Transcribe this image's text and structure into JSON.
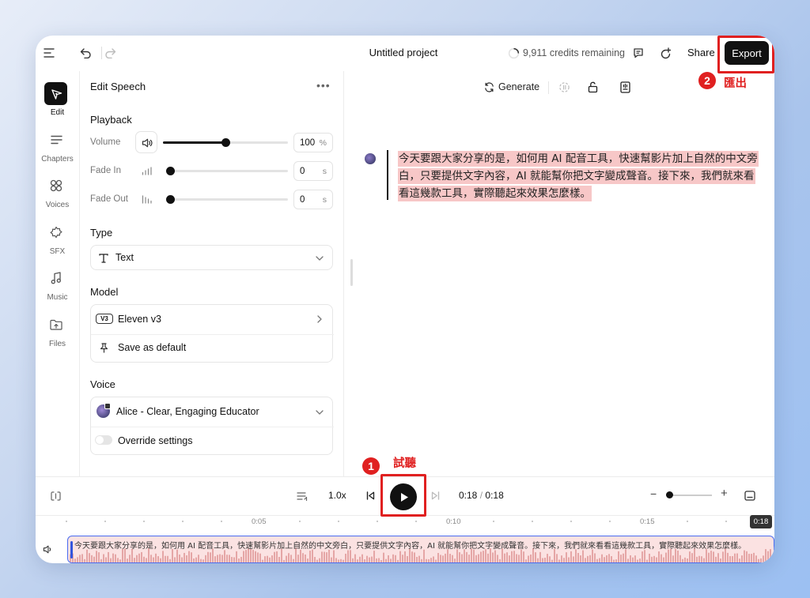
{
  "topbar": {
    "project_title": "Untitled project",
    "credits": "9,911 credits remaining",
    "share_label": "Share",
    "export_label": "Export"
  },
  "nav": {
    "items": [
      {
        "label": "Edit",
        "icon": "edit-pen-icon"
      },
      {
        "label": "Chapters",
        "icon": "chapters-icon"
      },
      {
        "label": "Voices",
        "icon": "voices-icon"
      },
      {
        "label": "SFX",
        "icon": "sfx-icon"
      },
      {
        "label": "Music",
        "icon": "music-icon"
      },
      {
        "label": "Files",
        "icon": "files-icon"
      }
    ]
  },
  "panel": {
    "title": "Edit Speech",
    "playback": {
      "title": "Playback",
      "volume": {
        "label": "Volume",
        "value": "100",
        "unit": "%",
        "level": 0.5
      },
      "fade_in": {
        "label": "Fade In",
        "value": "0",
        "unit": "s",
        "level": 0
      },
      "fade_out": {
        "label": "Fade Out",
        "value": "0",
        "unit": "s",
        "level": 0
      }
    },
    "type": {
      "title": "Type",
      "value": "Text"
    },
    "model": {
      "title": "Model",
      "badge": "V3",
      "value": "Eleven v3",
      "save_default": "Save as default"
    },
    "voice": {
      "title": "Voice",
      "value": "Alice - Clear, Engaging Educator",
      "override": "Override settings",
      "override_on": false
    }
  },
  "editor": {
    "generate_label": "Generate",
    "speech_text": "今天要跟大家分享的是，如何用 AI 配音工具，快速幫影片加上自然的中文旁白，只要提供文字內容，AI 就能幫你把文字變成聲音。接下來，我們就來看看這幾款工具，實際聽起來效果怎麼樣。"
  },
  "annotations": {
    "play": {
      "number": "1",
      "label": "試聽"
    },
    "export": {
      "number": "2",
      "label": "匯出"
    }
  },
  "player": {
    "speed": "1.0x",
    "current_time": "0:18",
    "separator": "/",
    "total_time": "0:18",
    "zoom_minus": "−",
    "zoom_plus": "+",
    "zoom_level": 0
  },
  "timeline": {
    "ticks": [
      "0:05",
      "0:10",
      "0:15"
    ],
    "playhead": "0:18",
    "clip_text": "今天要跟大家分享的是，如何用 AI 配音工具，快速幫影片加上自然的中文旁白，只要提供文字內容，AI 就能幫你把文字變成聲音。接下來，我們就來看看這幾款工具，實際聽起來效果怎麼樣。"
  },
  "colors": {
    "accent": "#111111",
    "highlight": "#e02020",
    "text_highlight": "#f7c7c7",
    "clip_border": "#4a6cf0"
  }
}
